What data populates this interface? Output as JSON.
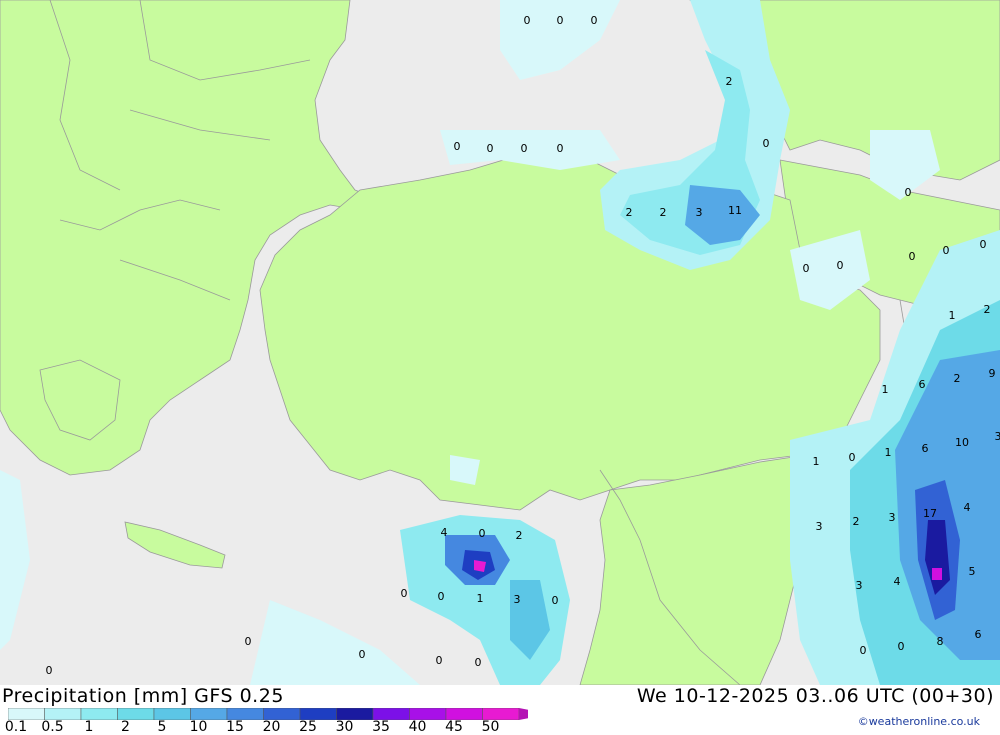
{
  "map": {
    "colors": {
      "sea": "#ececec",
      "land": "#c8fb9e",
      "border": "#9a9a9a"
    },
    "labels": [
      "0",
      "0",
      "0",
      "2",
      "0",
      "0",
      "0",
      "0",
      "0",
      "2",
      "2",
      "3",
      "11",
      "0",
      "0",
      "0",
      "0",
      "0",
      "0",
      "1",
      "2",
      "1",
      "6",
      "2",
      "9",
      "6",
      "10",
      "3",
      "1",
      "0",
      "1",
      "17",
      "4",
      "3",
      "2",
      "3",
      "4",
      "0",
      "2",
      "5",
      "3",
      "4",
      "0",
      "0",
      "1",
      "3",
      "0",
      "0",
      "0",
      "0",
      "0",
      "0",
      "8",
      "6",
      "0",
      "0"
    ]
  },
  "footer": {
    "title": "Precipitation [mm] GFS 0.25",
    "datetime": "We 10-12-2025 03..06 UTC (00+30)",
    "credit": "©weatheronline.co.uk"
  },
  "legend": {
    "ticks": [
      "0.1",
      "0.5",
      "1",
      "2",
      "5",
      "10",
      "15",
      "20",
      "25",
      "30",
      "35",
      "40",
      "45",
      "50"
    ],
    "colors": [
      "#d8f8fa",
      "#b4f2f6",
      "#8eeaf0",
      "#6ddbe8",
      "#5cc6e6",
      "#55a8e6",
      "#4588e0",
      "#3262d4",
      "#1e3ec2",
      "#1a1aa0",
      "#7c10e8",
      "#a810e8",
      "#d010e0",
      "#e81ad2",
      "#b414b4"
    ]
  }
}
